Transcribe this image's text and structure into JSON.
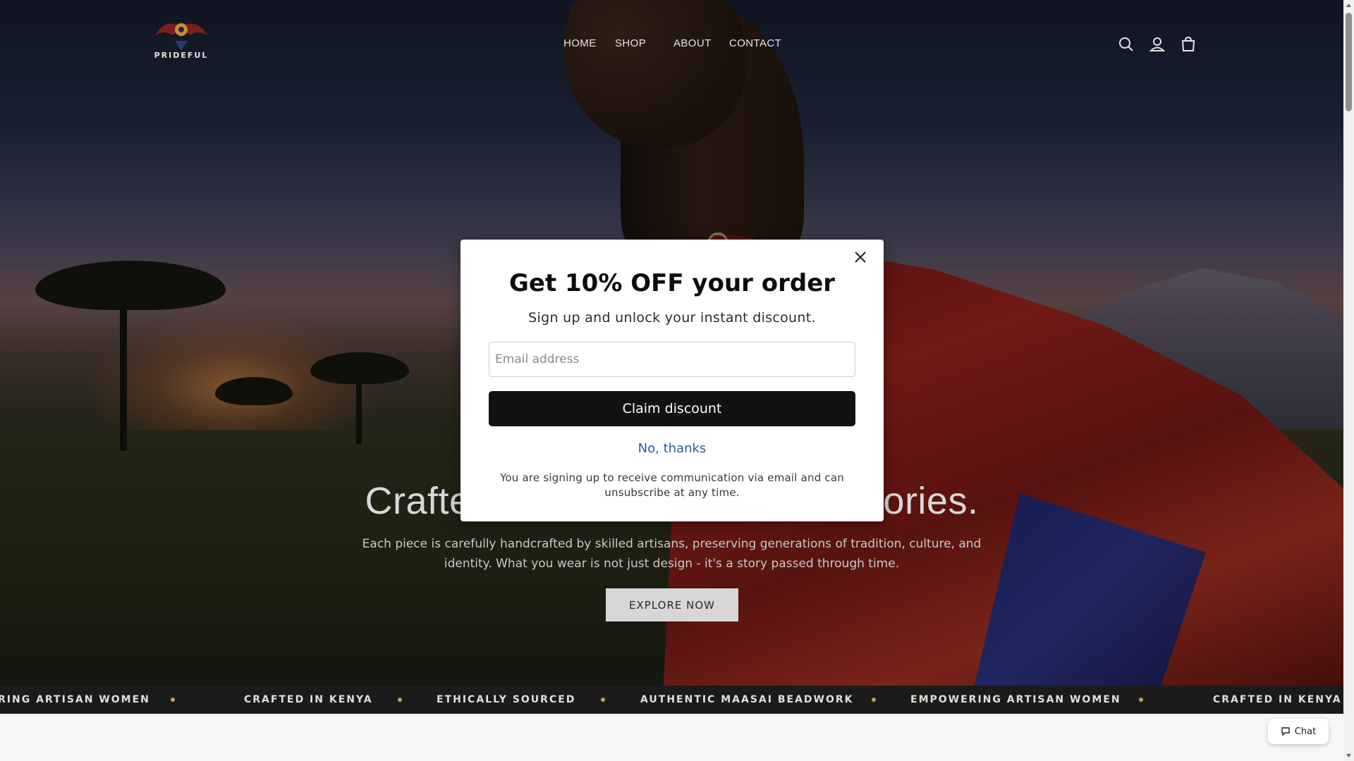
{
  "brand": {
    "logo_text": "PRIDEFUL"
  },
  "nav": {
    "items": [
      {
        "label": "HOME"
      },
      {
        "label": "SHOP"
      },
      {
        "label": "ABOUT"
      },
      {
        "label": "CONTACT"
      }
    ]
  },
  "header_icons": [
    "search-icon",
    "account-icon",
    "cart-icon"
  ],
  "hero": {
    "headline": "Crafted by Hand, Rooted in Stories.",
    "subtext_line1": "Each piece is carefully handcrafted by skilled artisans, preserving generations of tradition, culture, and",
    "subtext_line2": "identity. What you wear is not just design - it's a story passed through time.",
    "cta_label": "EXPLORE NOW"
  },
  "marquee": {
    "items": [
      "RING ARTISAN WOMEN",
      "CRAFTED IN KENYA",
      "ETHICALLY SOURCED",
      "AUTHENTIC MAASAI BEADWORK",
      "EMPOWERING ARTISAN WOMEN",
      "CRAFTED IN KENYA"
    ],
    "dot_color": "#c5a15a"
  },
  "modal": {
    "title": "Get 10% OFF your order",
    "subtitle": "Sign up and unlock your instant discount.",
    "email_placeholder": "Email address",
    "email_value": "",
    "claim_label": "Claim discount",
    "decline_label": "No, thanks",
    "fine_print_line1": "You are signing up to receive communication via email and can",
    "fine_print_line2": "unsubscribe at any time."
  },
  "chat": {
    "label": "Chat"
  },
  "colors": {
    "modal_button_bg": "#111111",
    "link_color": "#2c5aa0",
    "marquee_bg": "#1b1b1b"
  }
}
